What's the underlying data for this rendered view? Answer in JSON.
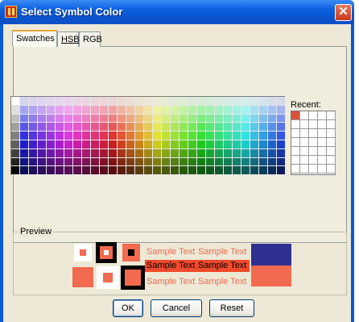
{
  "window": {
    "title": "Select Symbol Color"
  },
  "tabs": [
    {
      "label": "Swatches",
      "active": true
    },
    {
      "label": "HSB",
      "active": false
    },
    {
      "label": "RGB",
      "active": false
    }
  ],
  "recent": {
    "label": "Recent:",
    "first_color": "#d9503a"
  },
  "preview": {
    "label": "Preview",
    "sample_text": "Sample Text",
    "foreground_color": "#f26a4f",
    "background_color": "#2e3192",
    "selected_row_bg": "#f04a2c"
  },
  "buttons": {
    "ok": "OK",
    "cancel": "Cancel",
    "reset": "Reset"
  },
  "icons": {
    "app": "app-icon",
    "close": "close-icon"
  }
}
